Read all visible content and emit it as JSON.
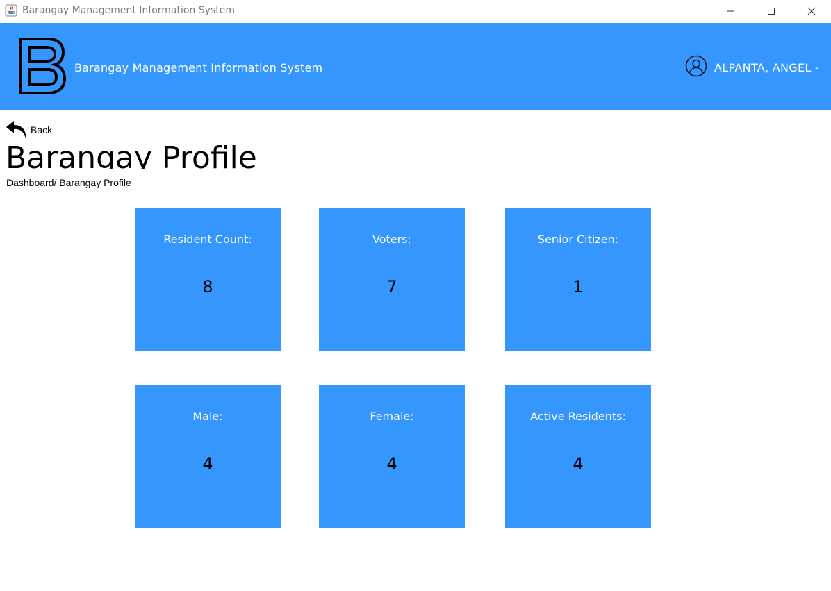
{
  "window": {
    "title": "Barangay Management Information System",
    "icon": "java-cup-icon",
    "controls": [
      "minimize-icon",
      "maximize-icon",
      "close-icon"
    ]
  },
  "header": {
    "logo_letter": "B",
    "app_name": "Barangay Management Information System",
    "user_name": "ALPANTA, ANGEL -",
    "user_icon": "user-circle-icon",
    "background_color": "#3597fd"
  },
  "nav": {
    "back_label": "Back",
    "back_icon": "back-arrow-icon"
  },
  "page": {
    "title": "Barangay Profile",
    "breadcrumb": "Dashboard/ Barangay Profile"
  },
  "cards": [
    {
      "label": "Resident Count:",
      "value": "8"
    },
    {
      "label": "Voters:",
      "value": "7"
    },
    {
      "label": "Senior Citizen:",
      "value": "1"
    },
    {
      "label": "Male:",
      "value": "4"
    },
    {
      "label": "Female:",
      "value": "4"
    },
    {
      "label": "Active Residents:",
      "value": "4"
    }
  ]
}
